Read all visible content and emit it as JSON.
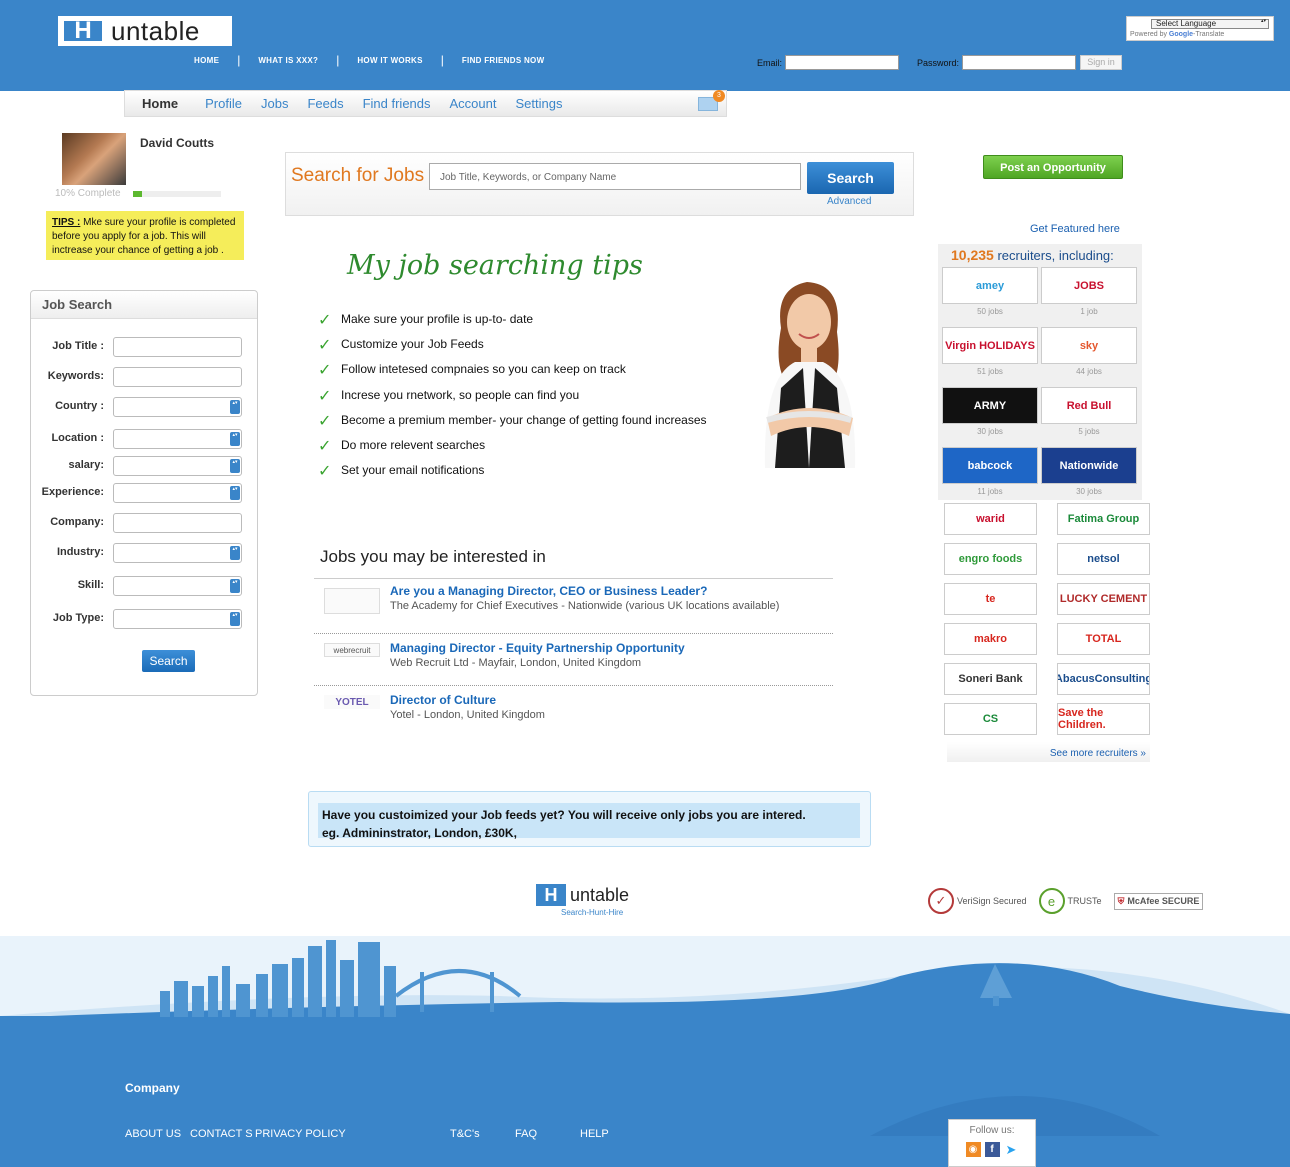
{
  "header": {
    "logo_letter": "H",
    "logo_word": "untable",
    "nav": [
      "HOME",
      "WHAT IS XXX?",
      "HOW IT WORKS",
      "FIND FRIENDS NOW"
    ],
    "translate_select": "Select Language",
    "translate_powered": "Powered by",
    "translate_google": "Google",
    "translate_label": "Translate",
    "email_label": "Email:",
    "password_label": "Password:",
    "signin_label": "Sign in"
  },
  "subnav": {
    "items": [
      "Home",
      "Profile",
      "Jobs",
      "Feeds",
      "Find friends",
      "Account",
      "Settings"
    ],
    "mail_count": "3"
  },
  "profile": {
    "name": "David Coutts",
    "complete_label": "10% Complete",
    "complete_fraction": 0.1,
    "tips_title": "TIPS :",
    "tips_text": " Mke sure your profile is completed before you apply for a job. This will inctrease your chance of getting a job ."
  },
  "job_search": {
    "title": "Job Search",
    "fields": [
      {
        "label": "Job Title :",
        "type": "text"
      },
      {
        "label": "Keywords:",
        "type": "text"
      },
      {
        "label": "Country :",
        "type": "select"
      },
      {
        "label": "Location :",
        "type": "select"
      },
      {
        "label": "salary:",
        "type": "select"
      },
      {
        "label": "Experience:",
        "type": "select"
      },
      {
        "label": "Company:",
        "type": "text"
      },
      {
        "label": "Industry:",
        "type": "select"
      },
      {
        "label": "Skill:",
        "type": "select"
      },
      {
        "label": "Job Type:",
        "type": "select"
      }
    ],
    "button": "Search"
  },
  "search_bar": {
    "title": "Search for Jobs",
    "placeholder": "Job Title, Keywords, or Company Name",
    "button": "Search",
    "advanced": "Advanced"
  },
  "tips_section": {
    "heading": "My job searching tips",
    "items": [
      "Make sure your profile is up-to- date",
      "Customize your Job Feeds",
      "Follow intetesed compnaies so you can keep on track",
      "Increse you rnetwork, so people can find you",
      "Become a premium member- your change of getting found increases",
      "Do more relevent searches",
      "Set your email notifications"
    ]
  },
  "jobs": {
    "heading": "Jobs you may be interested in",
    "items": [
      {
        "logo": "",
        "title": "Are you a Managing Director, CEO or Business Leader?",
        "sub": "The Academy for Chief Executives - Nationwide (various UK locations available)"
      },
      {
        "logo": "webrecruit",
        "title": "Managing Director - Equity Partnership Opportunity",
        "sub": "Web Recruit Ltd - Mayfair, London, United Kingdom"
      },
      {
        "logo": "YOTEL",
        "title": "Director of Culture",
        "sub": "Yotel - London, United Kingdom"
      }
    ]
  },
  "feed_banner": {
    "line1": "Have you custoimized your Job feeds yet? You will receive only jobs you are intered.",
    "line2": "eg. Admininstrator, London, £30K,"
  },
  "right": {
    "post_button": "Post an Opportunity",
    "featured_link": "Get Featured here",
    "recruiters_count": "10,235",
    "recruiters_label": " recruiters, including:",
    "featured_tiles": [
      {
        "name": "amey",
        "jobs": "50 jobs",
        "color": "#2a9bd8"
      },
      {
        "name": "JOBS",
        "jobs": "1 job",
        "color": "#c8102e"
      },
      {
        "name": "Virgin HOLIDAYS",
        "jobs": "51 jobs",
        "color": "#c8102e"
      },
      {
        "name": "sky",
        "jobs": "44 jobs",
        "color": "#e4572e"
      },
      {
        "name": "ARMY",
        "jobs": "30 jobs",
        "color": "#ffffff"
      },
      {
        "name": "Red Bull",
        "jobs": "5 jobs",
        "color": "#c8102e"
      },
      {
        "name": "babcock",
        "jobs": "11 jobs",
        "color": "#ffffff"
      },
      {
        "name": "Nationwide",
        "jobs": "30 jobs",
        "color": "#ffffff"
      }
    ],
    "logos": [
      {
        "name": "warid",
        "color": "#c8102e"
      },
      {
        "name": "Fatima Group",
        "color": "#1b8a3a"
      },
      {
        "name": "engro foods",
        "color": "#2f9a3a"
      },
      {
        "name": "netsol",
        "color": "#1b4d8c"
      },
      {
        "name": "te",
        "color": "#d7261e"
      },
      {
        "name": "LUCKY CEMENT",
        "color": "#b02a2a"
      },
      {
        "name": "makro",
        "color": "#d7261e"
      },
      {
        "name": "TOTAL",
        "color": "#d7261e"
      },
      {
        "name": "Soneri Bank",
        "color": "#333333"
      },
      {
        "name": "AbacusConsulting",
        "color": "#1b4d8c"
      },
      {
        "name": "CS",
        "color": "#1b8a3a"
      },
      {
        "name": "Save the Children.",
        "color": "#d7261e"
      }
    ],
    "see_more": "See more recruiters »"
  },
  "footer": {
    "logo_letter": "H",
    "logo_word": "untable",
    "tagline": "Search-Hunt-Hire",
    "seals": [
      "VeriSign Secured",
      "TRUSTe",
      "McAfee SECURE"
    ],
    "company_heading": "Company",
    "links": [
      "ABOUT US",
      "CONTACT S",
      "PRIVACY POLICY",
      "T&C's",
      "FAQ",
      "HELP"
    ],
    "follow_label": "Follow us:"
  },
  "colors": {
    "brand_blue": "#3a85c9",
    "accent_orange": "#e0781f",
    "tips_green": "#2e8a2e",
    "post_green": "#5cb82f"
  }
}
